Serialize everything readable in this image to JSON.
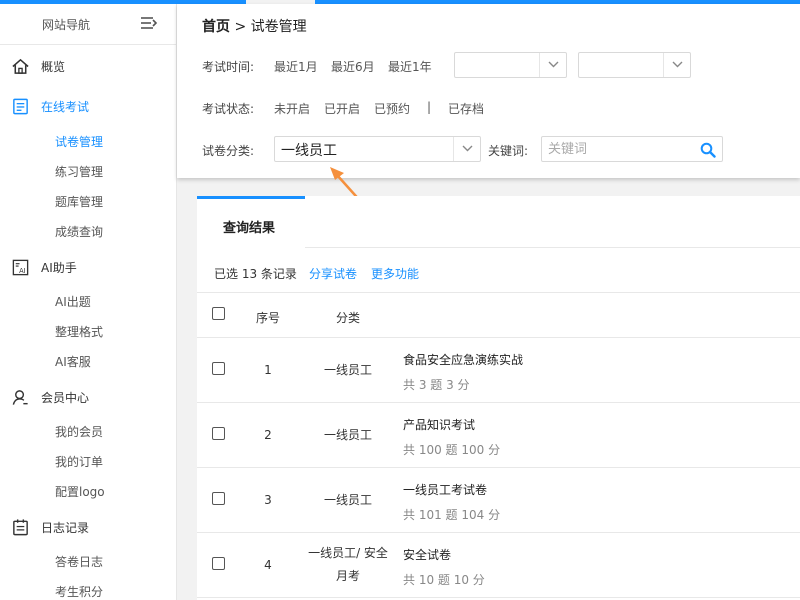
{
  "sidebar": {
    "title": "网站导航",
    "groups": [
      {
        "label": "概览",
        "icon": "home-icon"
      },
      {
        "label": "在线考试",
        "icon": "exam-list-icon",
        "items": [
          "试卷管理",
          "练习管理",
          "题库管理",
          "成绩查询"
        ]
      },
      {
        "label": "AI助手",
        "icon": "ai-assistant-icon",
        "items": [
          "AI出题",
          "整理格式",
          "AI客服"
        ]
      },
      {
        "label": "会员中心",
        "icon": "user-icon",
        "items": [
          "我的会员",
          "我的订单",
          "配置logo"
        ]
      },
      {
        "label": "日志记录",
        "icon": "log-icon",
        "items": [
          "答卷日志",
          "考生积分"
        ]
      }
    ]
  },
  "breadcrumb": {
    "home": "首页",
    "sep": ">",
    "current": "试卷管理"
  },
  "filters": {
    "exam_time": {
      "label": "考试时间:",
      "options": [
        "最近1月",
        "最近6月",
        "最近1年"
      ]
    },
    "exam_status": {
      "label": "考试状态:",
      "options": [
        "未开启",
        "已开启",
        "已预约"
      ],
      "sep": "|",
      "archived": "已存档"
    },
    "category": {
      "label": "试卷分类:",
      "value": "一线员工"
    },
    "keyword": {
      "label": "关键词:",
      "placeholder": "关键词"
    }
  },
  "results": {
    "tab": "查询结果",
    "selected_info": "已选 13 条记录",
    "actions": [
      "分享试卷",
      "更多功能"
    ],
    "columns": {
      "no": "序号",
      "category": "分类"
    },
    "rows": [
      {
        "no": "1",
        "category": [
          "一线员工"
        ],
        "title": "食品安全应急演练实战",
        "meta": "共 3 题 3 分"
      },
      {
        "no": "2",
        "category": [
          "一线员工"
        ],
        "title": "产品知识考试",
        "meta": "共 100 题 100 分"
      },
      {
        "no": "3",
        "category": [
          "一线员工"
        ],
        "title": "一线员工考试卷",
        "meta": "共 101 题 104 分"
      },
      {
        "no": "4",
        "category": [
          "一线员工/ 安全",
          "月考"
        ],
        "title": "安全试卷",
        "meta": "共 10 题 10 分"
      }
    ]
  },
  "colors": {
    "accent": "#1890ff",
    "annotation_arrow": "#f5903d"
  }
}
